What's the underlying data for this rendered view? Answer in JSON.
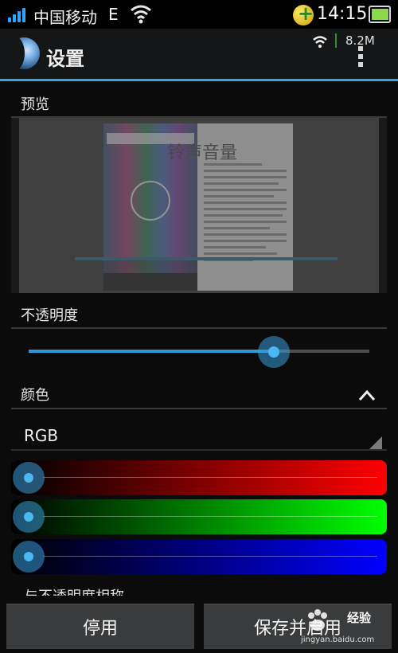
{
  "status_bar": {
    "carrier": "中国移动",
    "network_type": "E",
    "time": "14:15"
  },
  "action_bar": {
    "title": "设置",
    "net_speed": "8.2M"
  },
  "preview": {
    "label": "预览",
    "overlay_text": "铃声音量"
  },
  "opacity": {
    "label": "不透明度",
    "slider_value_percent": 72
  },
  "color": {
    "label": "颜色",
    "mode_value": "RGB",
    "red_value_percent": 0,
    "green_value_percent": 0,
    "blue_value_percent": 0
  },
  "truncated_option_label": "与不透明度相称",
  "buttons": {
    "disable_label": "停用",
    "save_enable_label": "保存并启用"
  },
  "watermark": {
    "text": "经验",
    "url": "jingyan.baidu.com"
  },
  "accent_color": "#3aa5dc"
}
